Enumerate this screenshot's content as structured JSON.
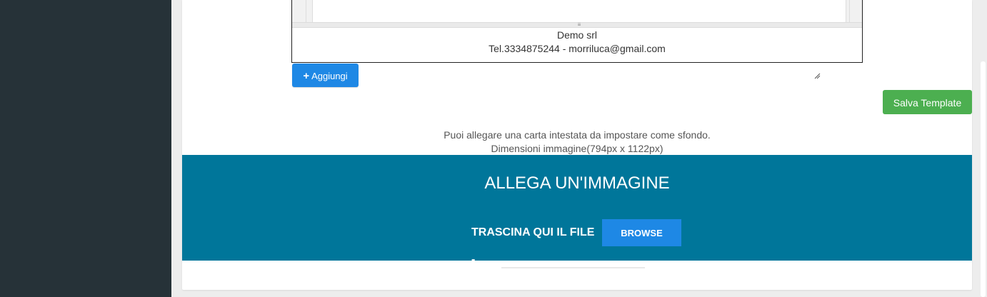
{
  "editor": {
    "footer_line1": "Demo srl",
    "footer_line2": "Tel.3334875244 - morriluca@gmail.com",
    "resize_glyph": "≡"
  },
  "actions": {
    "add_label": "Aggiungi",
    "add_icon": "+",
    "save_label": "Salva Template"
  },
  "note": {
    "line1": "Puoi allegare una carta intestata da impostare come sfondo.",
    "line2": "Dimensioni immagine(794px x 1122px)"
  },
  "dropzone": {
    "title": "ALLEGA UN'IMMAGINE",
    "drag_text": "TRASCINA QUI IL FILE -",
    "browse_label": "BROWSE"
  },
  "colors": {
    "sidebar": "#263238",
    "dropzone": "#00769a",
    "primary": "#1e88e5",
    "success": "#4caf50"
  }
}
